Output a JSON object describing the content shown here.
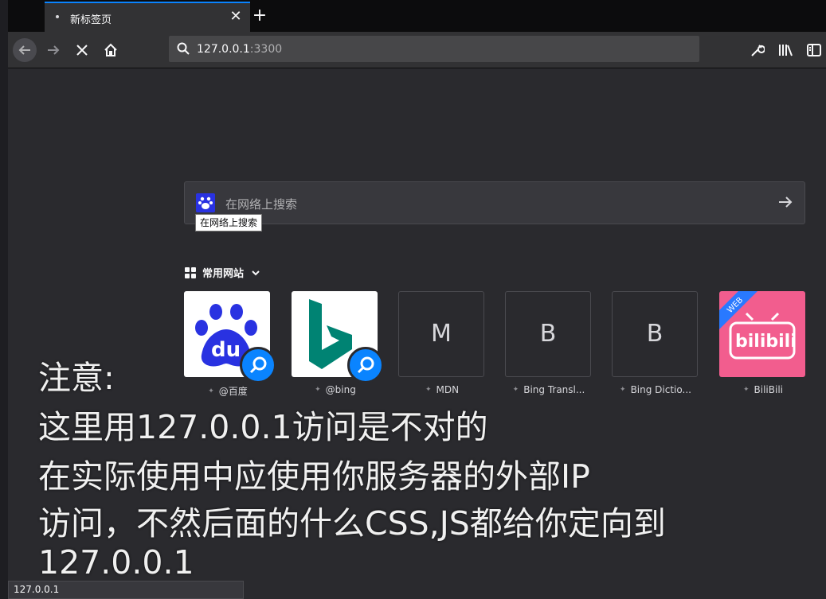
{
  "tab": {
    "title": "新标签页",
    "close": "✕",
    "new": "+"
  },
  "nav": {
    "url_host": "127.0.0.1",
    "url_port": ":3300"
  },
  "search": {
    "placeholder": "在网络上搜索",
    "tooltip": "在网络上搜索"
  },
  "top_sites": {
    "heading": "常用网站",
    "items": [
      {
        "label": "@百度",
        "tile": "baidu-logo"
      },
      {
        "label": "@bing",
        "tile": "bing-logo"
      },
      {
        "label": "MDN",
        "letter": "M"
      },
      {
        "label": "Bing Transl...",
        "letter": "B"
      },
      {
        "label": "Bing Dictio...",
        "letter": "B"
      },
      {
        "label": "BiliBili",
        "tile": "bilibili-logo"
      }
    ]
  },
  "note": {
    "line1": "注意:",
    "line2": "这里用127.0.0.1访问是不对的",
    "line3": "在实际使用中应使用你服务器的外部IP",
    "line4": "访问，不然后面的什么CSS,JS都给你定向到",
    "line5": "127.0.0.1"
  },
  "status": {
    "text": "127.0.0.1"
  },
  "colors": {
    "accent": "#0a84ff",
    "baidu": "#2932e1",
    "bing": "#008373",
    "bilibili": "#f25d8e"
  }
}
